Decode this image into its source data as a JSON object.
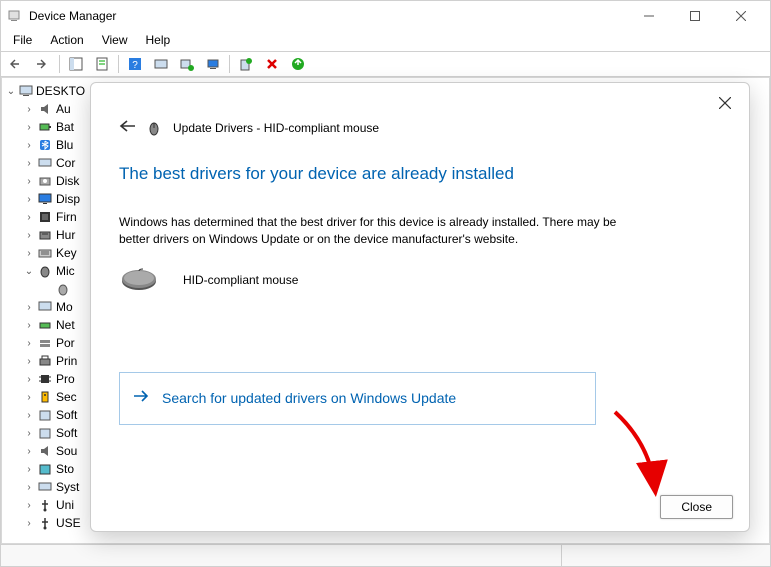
{
  "window": {
    "title": "Device Manager"
  },
  "menu": {
    "file": "File",
    "action": "Action",
    "view": "View",
    "help": "Help"
  },
  "tree": {
    "root": "DESKTO",
    "items": [
      {
        "label": "Au",
        "icon": "audio"
      },
      {
        "label": "Bat",
        "icon": "battery"
      },
      {
        "label": "Blu",
        "icon": "bluetooth"
      },
      {
        "label": "Cor",
        "icon": "computer"
      },
      {
        "label": "Disk",
        "icon": "disk"
      },
      {
        "label": "Disp",
        "icon": "display"
      },
      {
        "label": "Firn",
        "icon": "firmware"
      },
      {
        "label": "Hur",
        "icon": "hid"
      },
      {
        "label": "Key",
        "icon": "keyboard"
      },
      {
        "label": "Mic",
        "icon": "mouse",
        "expanded": true,
        "children": [
          {
            "label": "",
            "icon": "mouse-sub"
          }
        ]
      },
      {
        "label": "Mo",
        "icon": "monitor"
      },
      {
        "label": "Net",
        "icon": "network"
      },
      {
        "label": "Por",
        "icon": "port"
      },
      {
        "label": "Prin",
        "icon": "printer"
      },
      {
        "label": "Pro",
        "icon": "processor"
      },
      {
        "label": "Sec",
        "icon": "security"
      },
      {
        "label": "Soft",
        "icon": "software"
      },
      {
        "label": "Soft",
        "icon": "software2"
      },
      {
        "label": "Sou",
        "icon": "sound"
      },
      {
        "label": "Sto",
        "icon": "storage"
      },
      {
        "label": "Syst",
        "icon": "system"
      },
      {
        "label": "Uni",
        "icon": "usb"
      },
      {
        "label": "USE",
        "icon": "usb2"
      }
    ]
  },
  "dialog": {
    "title": "Update Drivers - HID-compliant mouse",
    "heading": "The best drivers for your device are already installed",
    "body": "Windows has determined that the best driver for this device is already installed. There may be better drivers on Windows Update or on the device manufacturer's website.",
    "device_name": "HID-compliant mouse",
    "link": "Search for updated drivers on Windows Update",
    "close_btn": "Close"
  }
}
